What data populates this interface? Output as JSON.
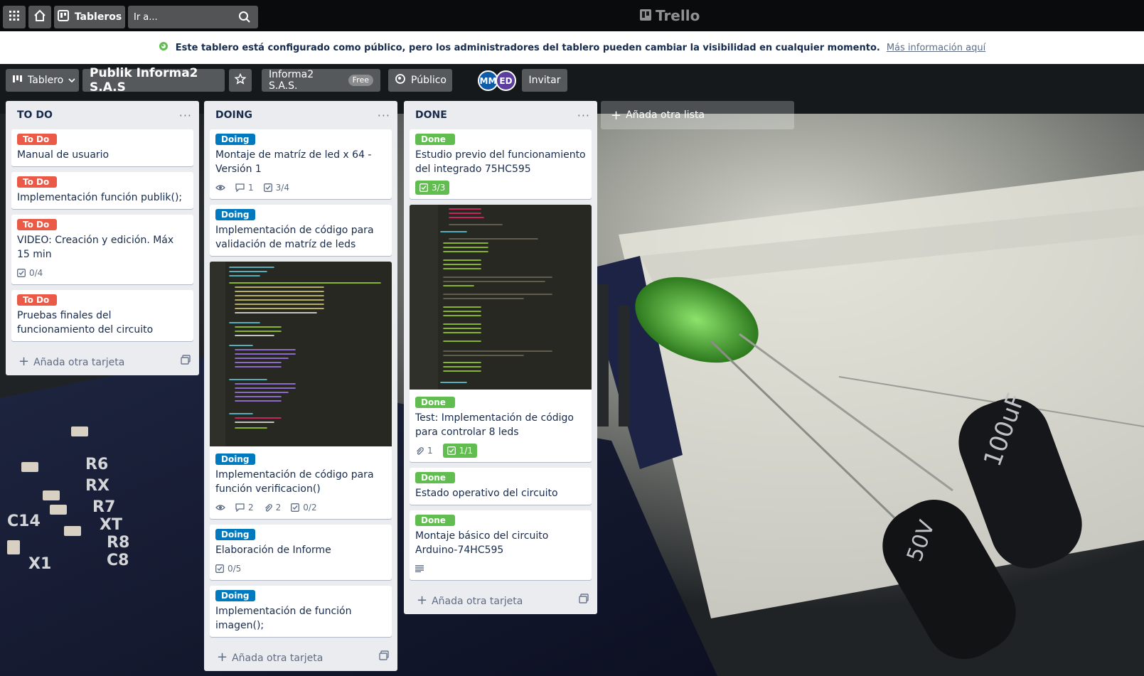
{
  "header": {
    "boards_label": "Tableros",
    "search_placeholder": "Ir a...",
    "logo_text": "Trello"
  },
  "banner": {
    "message": "Este tablero está configurado como público, pero los administradores del tablero pueden cambiar la visibilidad en cualquier momento.",
    "link": "Más información aquí"
  },
  "board_header": {
    "view_label": "Tablero",
    "board_name": "Publik Informa2 S.A.S",
    "team_name": "Informa2 S.A.S.",
    "plan_badge": "Free",
    "visibility": "Público",
    "members": [
      "MM",
      "ED"
    ],
    "invite_label": "Invitar"
  },
  "lists": [
    {
      "title": "TO DO",
      "add_card": "Añada otra tarjeta",
      "cards": [
        {
          "label": "To Do",
          "title": "Manual de usuario"
        },
        {
          "label": "To Do",
          "title": "Implementación función publik();"
        },
        {
          "label": "To Do",
          "title": "VIDEO: Creación y edición. Máx 15 min",
          "checklist": "0/4"
        },
        {
          "label": "To Do",
          "title": "Pruebas finales del funcionamiento del circuito"
        }
      ]
    },
    {
      "title": "DOING",
      "add_card": "Añada otra tarjeta",
      "cards": [
        {
          "label": "Doing",
          "title": "Montaje de matríz de led x 64 - Versión 1",
          "comments": "1",
          "checklist": "3/4"
        },
        {
          "label": "Doing",
          "title": "Implementación de código para validación de matríz de leds"
        },
        {
          "label": "Doing",
          "title": "Implementación de código para función verificacion()",
          "comments": "2",
          "attachments": "2",
          "checklist": "0/2"
        },
        {
          "label": "Doing",
          "title": "Elaboración de Informe",
          "checklist": "0/5"
        },
        {
          "label": "Doing",
          "title": "Implementación de función imagen();"
        }
      ]
    },
    {
      "title": "DONE",
      "add_card": "Añada otra tarjeta",
      "cards": [
        {
          "label": "Done",
          "title": "Estudio previo del funcionamiento del integrado 75HC595",
          "checklist": "3/3"
        },
        {
          "label": "Done",
          "title": "Test: Implementación de código para controlar 8 leds",
          "attachments": "1",
          "checklist": "1/1"
        },
        {
          "label": "Done",
          "title": "Estado operativo del circuito"
        },
        {
          "label": "Done",
          "title": "Montaje básico del circuito Arduino-74HC595"
        }
      ]
    }
  ],
  "add_list": "Añada otra lista",
  "colors": {
    "todo": "#eb5a46",
    "doing": "#0079bf",
    "done": "#61bd4f"
  }
}
